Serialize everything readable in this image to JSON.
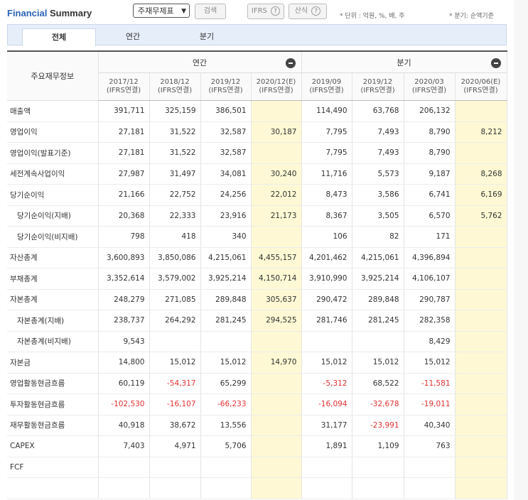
{
  "header": {
    "title_part1": "Financial",
    "title_part2": "Summary",
    "select_value": "주재무제표",
    "search_label": "검색",
    "ifrs_label": "IFRS",
    "formula_label": "산식",
    "help_glyph": "?",
    "units_note": "* 단위 : 억원, %, 배, 주",
    "quarter_note": "* 분기: 순액기준"
  },
  "tabs": [
    {
      "label": "전체",
      "active": true
    },
    {
      "label": "연간",
      "active": false
    },
    {
      "label": "분기",
      "active": false
    }
  ],
  "table": {
    "row_header": "주요재무정보",
    "group_annual": "연간",
    "group_quarter": "분기",
    "columns": [
      {
        "period": "2017/12",
        "basis": "(IFRS연결)"
      },
      {
        "period": "2018/12",
        "basis": "(IFRS연결)"
      },
      {
        "period": "2019/12",
        "basis": "(IFRS연결)"
      },
      {
        "period": "2020/12(E)",
        "basis": "(IFRS연결)"
      },
      {
        "period": "2019/09",
        "basis": "(IFRS연결)"
      },
      {
        "period": "2019/12",
        "basis": "(IFRS연결)"
      },
      {
        "period": "2020/03",
        "basis": "(IFRS연결)"
      },
      {
        "period": "2020/06(E)",
        "basis": "(IFRS연결)"
      }
    ],
    "rows": [
      {
        "label": "매출액",
        "indent": false,
        "values": [
          "391,711",
          "325,159",
          "386,501",
          "",
          "114,490",
          "63,768",
          "206,132",
          ""
        ]
      },
      {
        "label": "영업이익",
        "indent": false,
        "values": [
          "27,181",
          "31,522",
          "32,587",
          "30,187",
          "7,795",
          "7,493",
          "8,790",
          "8,212"
        ]
      },
      {
        "label": "영업이익(발표기준)",
        "indent": false,
        "values": [
          "27,181",
          "31,522",
          "32,587",
          "",
          "7,795",
          "7,493",
          "8,790",
          ""
        ]
      },
      {
        "label": "세전계속사업이익",
        "indent": false,
        "values": [
          "27,987",
          "31,497",
          "34,081",
          "30,240",
          "11,716",
          "5,573",
          "9,187",
          "8,268"
        ]
      },
      {
        "label": "당기순이익",
        "indent": false,
        "values": [
          "21,166",
          "22,752",
          "24,256",
          "22,012",
          "8,473",
          "3,586",
          "6,741",
          "6,169"
        ]
      },
      {
        "label": "당기순이익(지배)",
        "indent": true,
        "values": [
          "20,368",
          "22,333",
          "23,916",
          "21,173",
          "8,367",
          "3,505",
          "6,570",
          "5,762"
        ]
      },
      {
        "label": "당기순이익(비지배)",
        "indent": true,
        "values": [
          "798",
          "418",
          "340",
          "",
          "106",
          "82",
          "171",
          ""
        ]
      },
      {
        "label": "자산총계",
        "indent": false,
        "values": [
          "3,600,893",
          "3,850,086",
          "4,215,061",
          "4,455,157",
          "4,201,462",
          "4,215,061",
          "4,396,894",
          ""
        ]
      },
      {
        "label": "부채총계",
        "indent": false,
        "values": [
          "3,352,614",
          "3,579,002",
          "3,925,214",
          "4,150,714",
          "3,910,990",
          "3,925,214",
          "4,106,107",
          ""
        ]
      },
      {
        "label": "자본총계",
        "indent": false,
        "values": [
          "248,279",
          "271,085",
          "289,848",
          "305,637",
          "290,472",
          "289,848",
          "290,787",
          ""
        ]
      },
      {
        "label": "자본총계(지배)",
        "indent": true,
        "values": [
          "238,737",
          "264,292",
          "281,245",
          "294,525",
          "281,746",
          "281,245",
          "282,358",
          ""
        ]
      },
      {
        "label": "자본총계(비지배)",
        "indent": true,
        "values": [
          "9,543",
          "",
          "",
          "",
          "",
          "",
          "8,429",
          ""
        ]
      },
      {
        "label": "자본금",
        "indent": false,
        "values": [
          "14,800",
          "15,012",
          "15,012",
          "14,970",
          "15,012",
          "15,012",
          "15,012",
          ""
        ]
      },
      {
        "label": "영업활동현금흐름",
        "indent": false,
        "values": [
          "60,119",
          "-54,317",
          "65,299",
          "",
          "-5,312",
          "68,522",
          "-11,581",
          ""
        ]
      },
      {
        "label": "투자활동현금흐름",
        "indent": false,
        "values": [
          "-102,530",
          "-16,107",
          "-66,233",
          "",
          "-16,094",
          "-32,678",
          "-19,011",
          ""
        ]
      },
      {
        "label": "재무활동현금흐름",
        "indent": false,
        "values": [
          "40,918",
          "38,672",
          "13,556",
          "",
          "31,177",
          "-23,991",
          "40,340",
          ""
        ]
      },
      {
        "label": "CAPEX",
        "indent": false,
        "values": [
          "7,403",
          "4,971",
          "5,706",
          "",
          "1,891",
          "1,109",
          "763",
          ""
        ]
      },
      {
        "label": "FCF",
        "indent": false,
        "values": [
          "",
          "",
          "",
          "",
          "",
          "",
          "",
          ""
        ]
      },
      {
        "label": "",
        "indent": false,
        "values": [
          "",
          "",
          "",
          "",
          "",
          "",
          "",
          ""
        ]
      }
    ],
    "negative_color": "#e03131",
    "estimate_bg": "#fef9d4"
  }
}
